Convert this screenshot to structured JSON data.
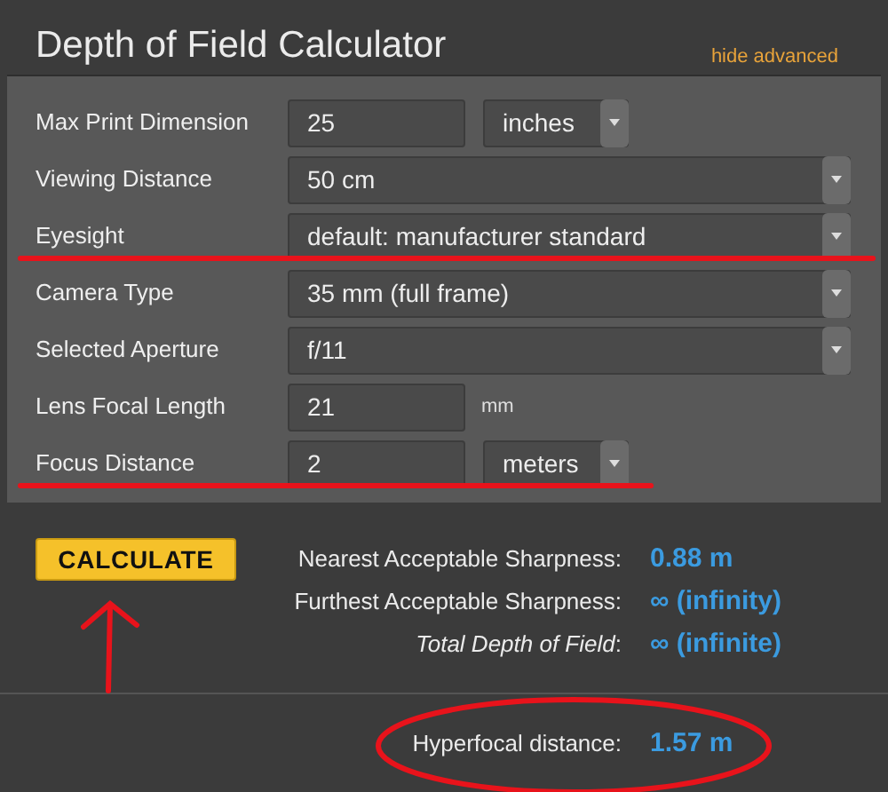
{
  "window": {
    "title": "Depth of Field Calculator",
    "toggle_link": "hide advanced"
  },
  "fields": [
    {
      "label": "Max Print Dimension",
      "kind": "input",
      "value": "25",
      "unit": {
        "kind": "select",
        "value": "inches"
      },
      "struck": false
    },
    {
      "label": "Viewing Distance",
      "kind": "select",
      "value": "50 cm",
      "struck": false
    },
    {
      "label": "Eyesight",
      "kind": "select",
      "value": "default: manufacturer standard",
      "struck": true
    },
    {
      "label": "Camera Type",
      "kind": "select",
      "value": "35 mm (full frame)",
      "struck": false
    },
    {
      "label": "Selected Aperture",
      "kind": "select",
      "value": "f/11",
      "struck": false
    },
    {
      "label": "Lens Focal Length",
      "kind": "input",
      "value": "21",
      "unit": {
        "kind": "text",
        "value": "mm"
      },
      "struck": false
    },
    {
      "label": "Focus Distance",
      "kind": "input",
      "value": "2",
      "unit": {
        "kind": "select",
        "value": "meters"
      },
      "struck": true
    }
  ],
  "calculate_button": {
    "label": "CALCULATE",
    "arrow_mark": true
  },
  "results": [
    {
      "label": "Nearest Acceptable Sharpness:",
      "value": "0.88 m"
    },
    {
      "label": "Furthest Acceptable Sharpness:",
      "value": "∞ (infinity)"
    },
    {
      "label": "*Total Depth of Field*:",
      "value": "∞ (infinite)"
    }
  ],
  "hyperfocal": {
    "label": "Hyperfocal distance:",
    "value": "1.57 m",
    "circled": true
  }
}
